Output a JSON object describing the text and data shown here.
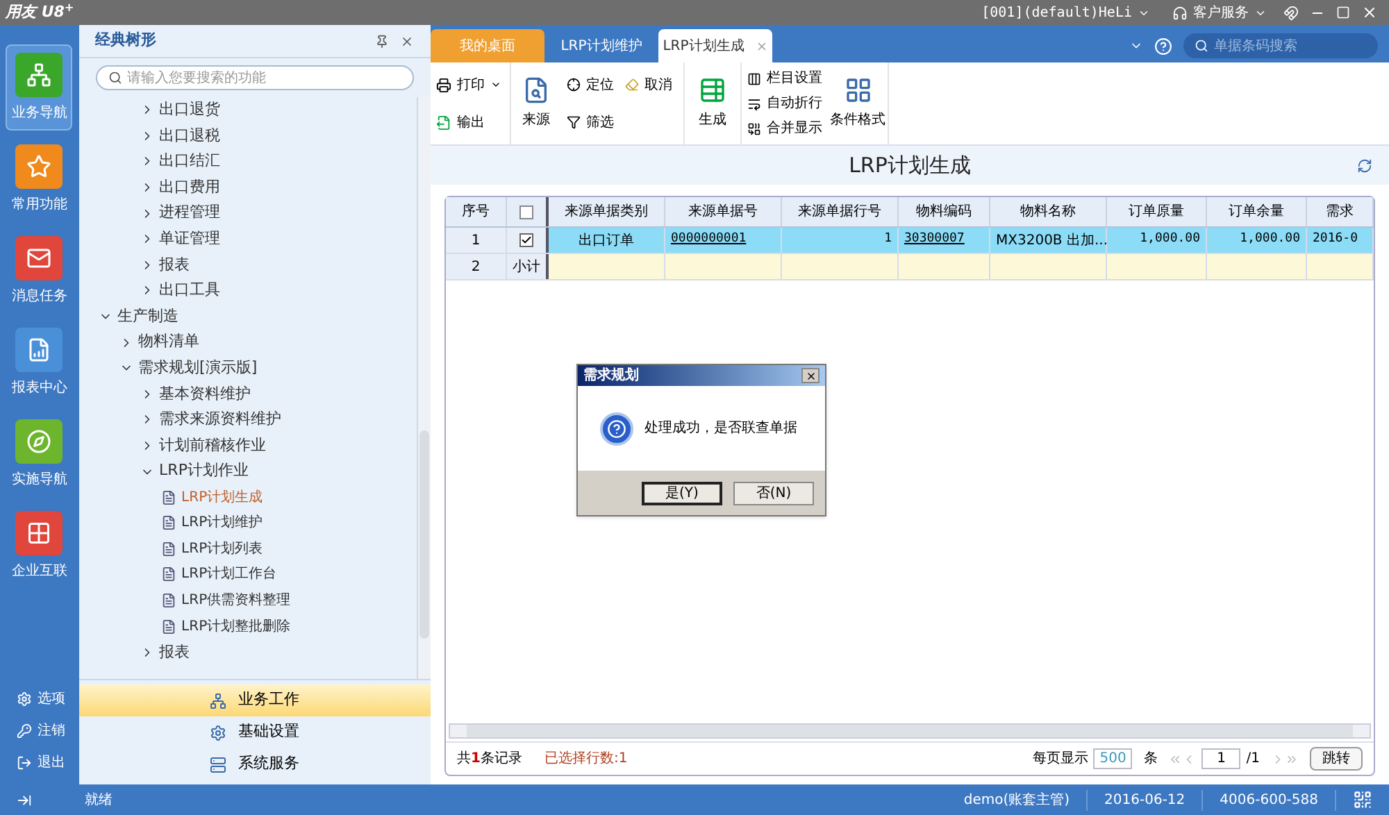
{
  "app_bar": {
    "logo": "用友 U8",
    "logo_sup": "+",
    "account": "[001](default)HeLi",
    "service": "客户服务"
  },
  "rail": {
    "items": [
      {
        "label": "业务导航",
        "selected": true
      },
      {
        "label": "常用功能",
        "selected": false
      },
      {
        "label": "消息任务",
        "selected": false
      },
      {
        "label": "报表中心",
        "selected": false
      },
      {
        "label": "实施导航",
        "selected": false
      },
      {
        "label": "企业互联",
        "selected": false
      }
    ],
    "bottom": [
      "选项",
      "注销",
      "退出"
    ]
  },
  "tree_panel": {
    "title": "经典树形",
    "search_placeholder": "请输入您要搜索的功能",
    "continued_items": [
      {
        "label": "出口退货",
        "expanded": false
      },
      {
        "label": "出口退税",
        "expanded": false
      },
      {
        "label": "出口结汇",
        "expanded": false
      },
      {
        "label": "出口费用",
        "expanded": false
      },
      {
        "label": "进程管理",
        "expanded": false
      },
      {
        "label": "单证管理",
        "expanded": false
      },
      {
        "label": "报表",
        "expanded": false
      },
      {
        "label": "出口工具",
        "expanded": false
      }
    ],
    "items": [
      {
        "label": "生产制造",
        "expanded": true,
        "children": [
          {
            "label": "物料清单",
            "expanded": false
          },
          {
            "label": "需求规划[演示版]",
            "expanded": true,
            "children": [
              {
                "label": "基本资料维护",
                "expanded": false
              },
              {
                "label": "需求来源资料维护",
                "expanded": false
              },
              {
                "label": "计划前稽核作业",
                "expanded": false
              },
              {
                "label": "LRP计划作业",
                "expanded": true,
                "children": [
                  {
                    "kind": "leaf",
                    "label": "LRP计划生成",
                    "selected": true
                  },
                  {
                    "kind": "leaf",
                    "label": "LRP计划维护",
                    "selected": false
                  },
                  {
                    "kind": "leaf",
                    "label": "LRP计划列表",
                    "selected": false
                  },
                  {
                    "kind": "leaf",
                    "label": "LRP计划工作台",
                    "selected": false
                  },
                  {
                    "kind": "leaf",
                    "label": "LRP供需资料整理",
                    "selected": false
                  },
                  {
                    "kind": "leaf",
                    "label": "LRP计划整批删除",
                    "selected": false
                  }
                ]
              },
              {
                "label": "报表",
                "expanded": false
              }
            ]
          }
        ]
      }
    ],
    "sections": [
      {
        "label": "业务工作",
        "selected": true
      },
      {
        "label": "基础设置",
        "selected": false
      },
      {
        "label": "系统服务",
        "selected": false
      }
    ]
  },
  "tabs": [
    {
      "label": "我的桌面",
      "selected": false
    },
    {
      "label": "LRP计划维护",
      "selected": false
    },
    {
      "label": "LRP计划生成",
      "selected": true
    }
  ],
  "barcode_search_placeholder": "单据条码搜索",
  "toolbar": {
    "print": "打印",
    "export": "输出",
    "source": "来源",
    "locate": "定位",
    "cancel": "取消",
    "filter": "筛选",
    "generate": "生成",
    "columns": "栏目设置",
    "wrap": "自动折行",
    "merge": "合并显示",
    "conditional_format": "条件格式"
  },
  "page_title": "LRP计划生成",
  "table": {
    "columns": [
      "序号",
      "",
      "来源单据类别",
      "来源单据号",
      "来源单据行号",
      "物料编码",
      "物料名称",
      "订单原量",
      "订单余量",
      "需求"
    ],
    "header_checked": false,
    "rows": [
      {
        "kind": "data",
        "selected": true,
        "checked": true,
        "cells": [
          "1",
          "",
          "出口订单",
          "0000000001",
          "1",
          "30300007",
          "MX3200B 出加...",
          "1,000.00",
          "1,000.00",
          "2016-0"
        ]
      },
      {
        "kind": "subtotal",
        "selected": false,
        "cells": [
          "2",
          "小计",
          "",
          "",
          "",
          "",
          "",
          "",
          "",
          ""
        ]
      }
    ]
  },
  "footer": {
    "count": "共**1**条记录",
    "selected_count": "已选择行数:1",
    "per_page_label": "每页显示",
    "per_page": "500",
    "per_page_unit": "条",
    "page": "1",
    "pages": "/1",
    "jump": "跳转"
  },
  "dialog": {
    "title": "需求规划",
    "message": "处理成功，是否联查单据",
    "buttons": [
      "是(Y)",
      "否(N)"
    ]
  },
  "status_bar": {
    "status": "就绪",
    "user": "demo(账套主管)",
    "date": "2016-06-12",
    "phone": "4006-600-588"
  }
}
